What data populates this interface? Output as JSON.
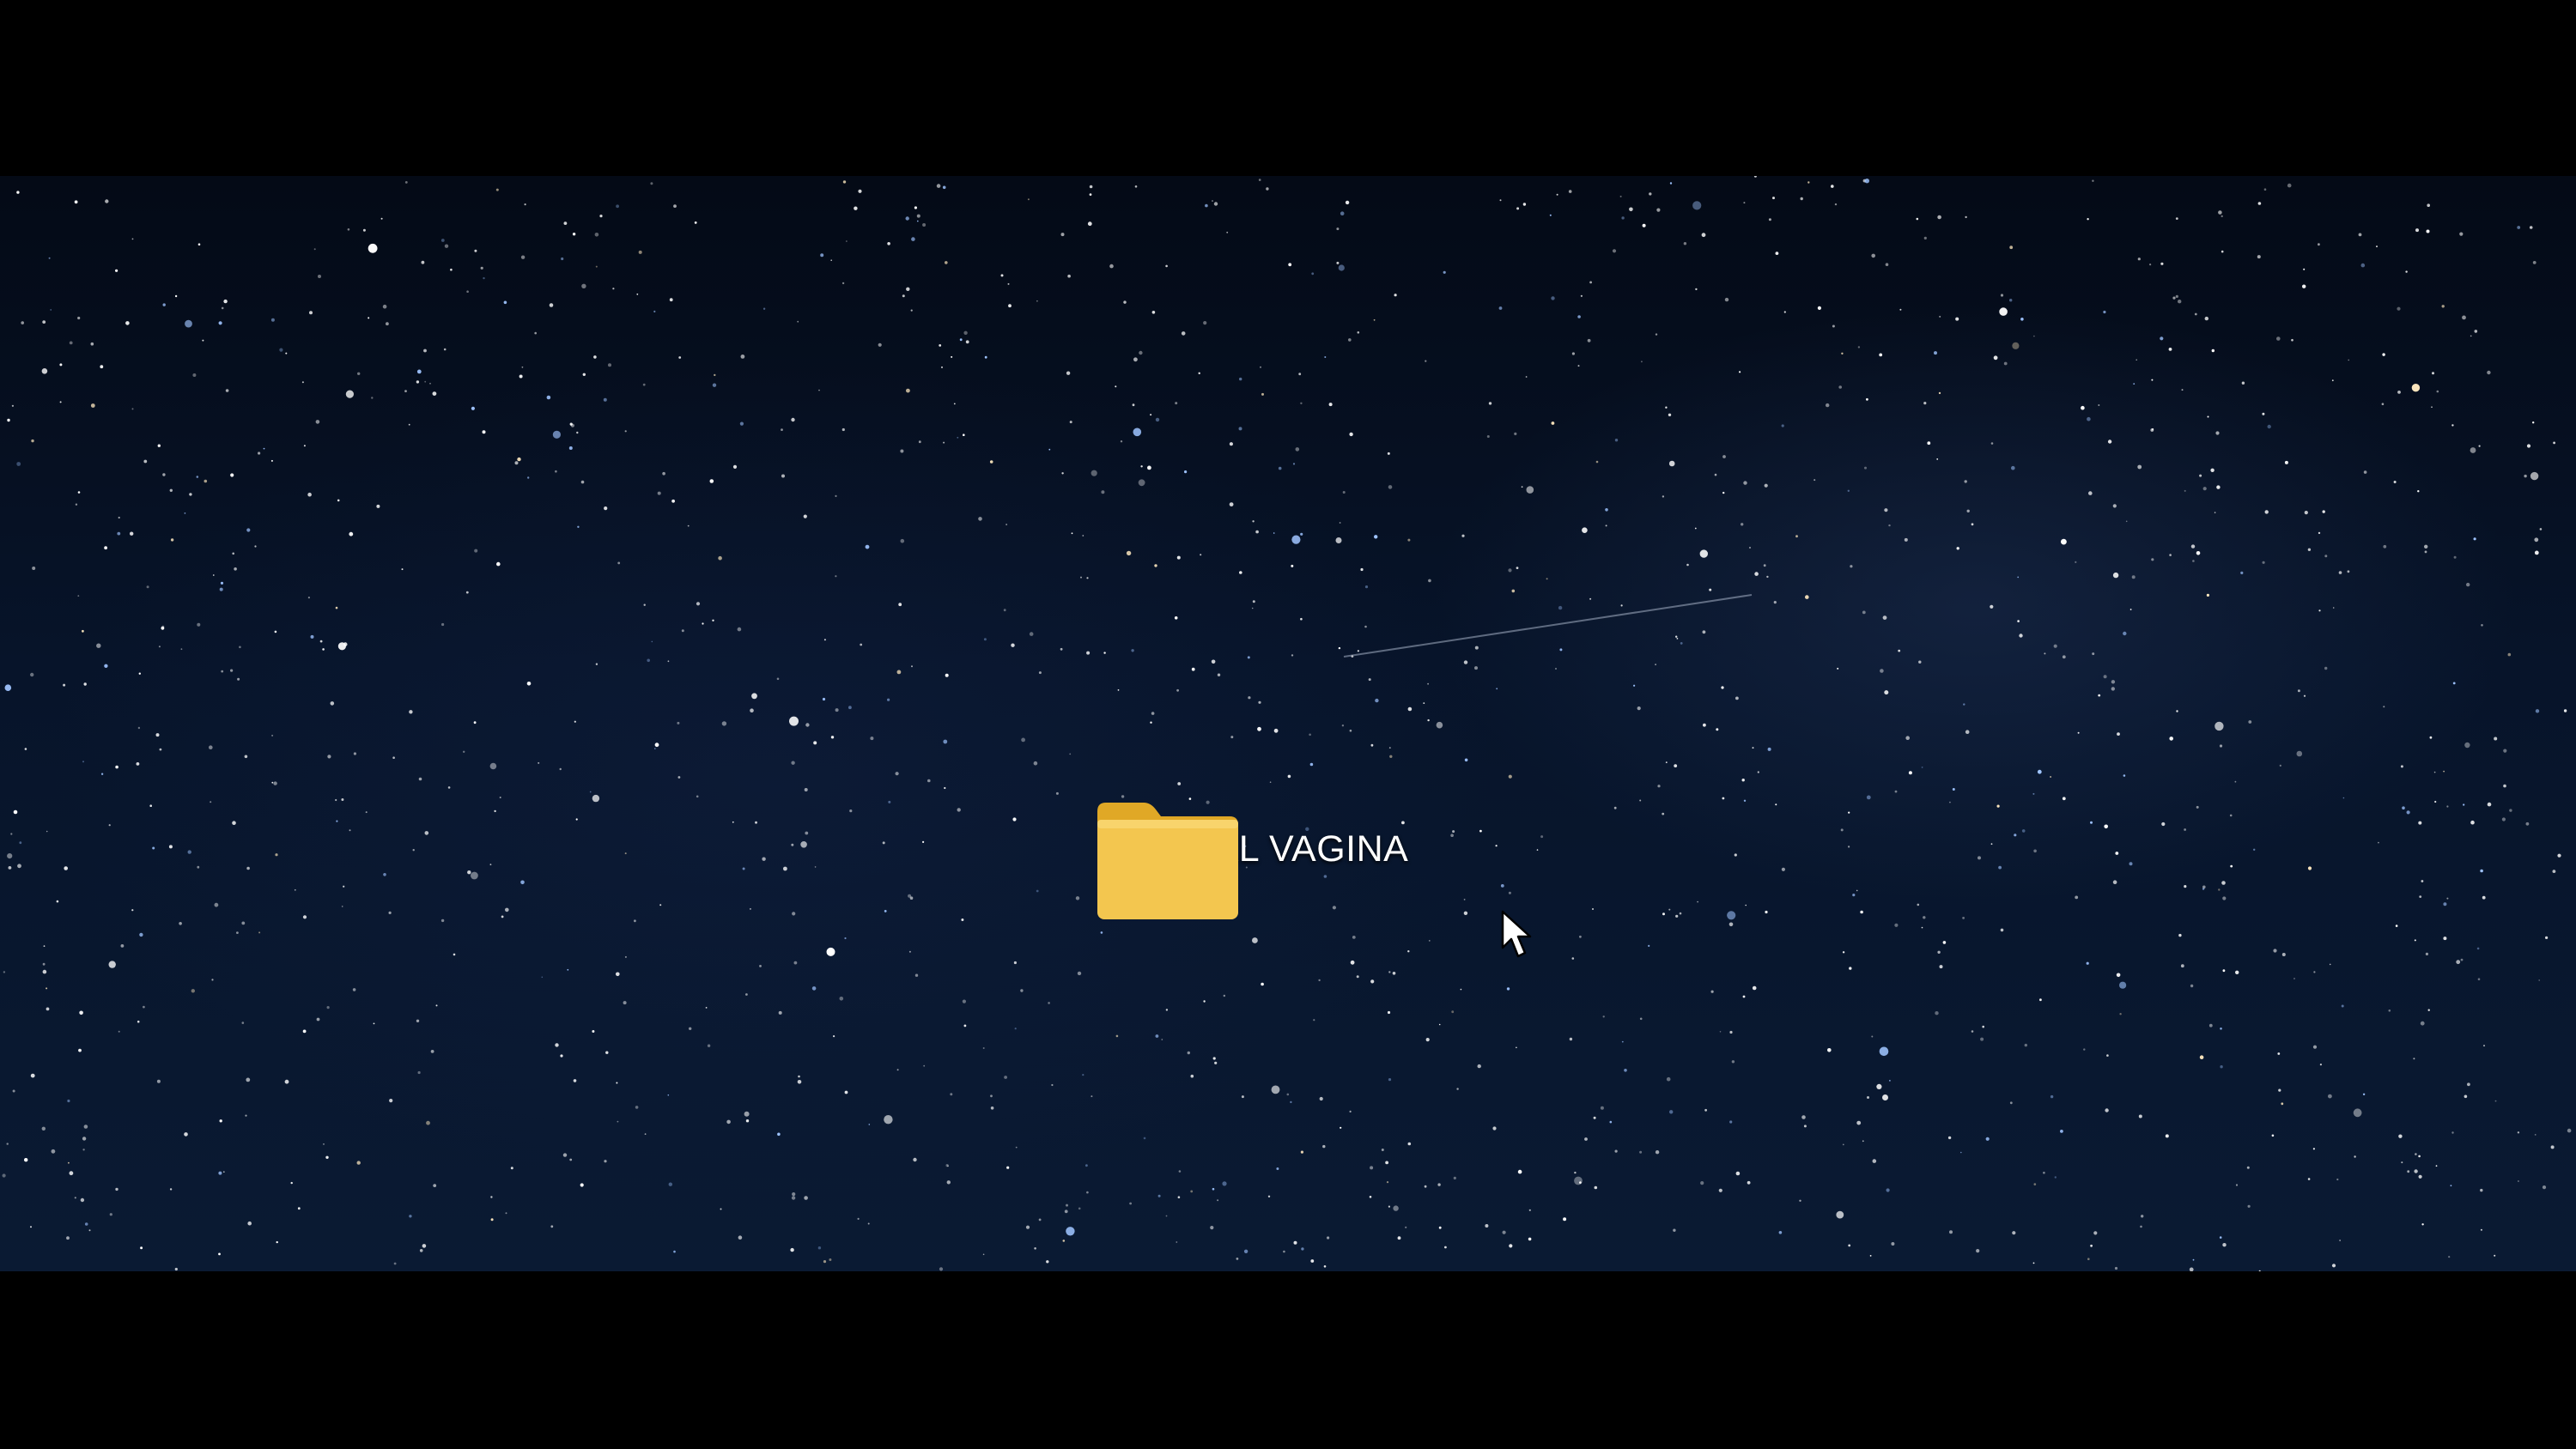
{
  "desktop": {
    "wallpaper": "starry-night-sky",
    "background_color": "#07142a",
    "letterbox_color": "#000000"
  },
  "icons": [
    {
      "label": "DIGITAL VAGINA",
      "type": "folder-icon",
      "color": "#f0c040"
    }
  ],
  "cursor": {
    "type": "arrow-pointer-icon"
  }
}
